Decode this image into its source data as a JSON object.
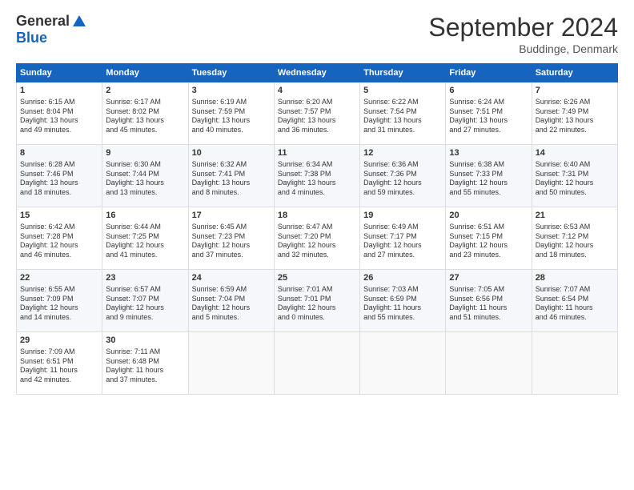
{
  "header": {
    "logo_general": "General",
    "logo_blue": "Blue",
    "month_title": "September 2024",
    "location": "Buddinge, Denmark"
  },
  "days_of_week": [
    "Sunday",
    "Monday",
    "Tuesday",
    "Wednesday",
    "Thursday",
    "Friday",
    "Saturday"
  ],
  "weeks": [
    [
      {
        "day": "1",
        "info": "Sunrise: 6:15 AM\nSunset: 8:04 PM\nDaylight: 13 hours\nand 49 minutes."
      },
      {
        "day": "2",
        "info": "Sunrise: 6:17 AM\nSunset: 8:02 PM\nDaylight: 13 hours\nand 45 minutes."
      },
      {
        "day": "3",
        "info": "Sunrise: 6:19 AM\nSunset: 7:59 PM\nDaylight: 13 hours\nand 40 minutes."
      },
      {
        "day": "4",
        "info": "Sunrise: 6:20 AM\nSunset: 7:57 PM\nDaylight: 13 hours\nand 36 minutes."
      },
      {
        "day": "5",
        "info": "Sunrise: 6:22 AM\nSunset: 7:54 PM\nDaylight: 13 hours\nand 31 minutes."
      },
      {
        "day": "6",
        "info": "Sunrise: 6:24 AM\nSunset: 7:51 PM\nDaylight: 13 hours\nand 27 minutes."
      },
      {
        "day": "7",
        "info": "Sunrise: 6:26 AM\nSunset: 7:49 PM\nDaylight: 13 hours\nand 22 minutes."
      }
    ],
    [
      {
        "day": "8",
        "info": "Sunrise: 6:28 AM\nSunset: 7:46 PM\nDaylight: 13 hours\nand 18 minutes."
      },
      {
        "day": "9",
        "info": "Sunrise: 6:30 AM\nSunset: 7:44 PM\nDaylight: 13 hours\nand 13 minutes."
      },
      {
        "day": "10",
        "info": "Sunrise: 6:32 AM\nSunset: 7:41 PM\nDaylight: 13 hours\nand 8 minutes."
      },
      {
        "day": "11",
        "info": "Sunrise: 6:34 AM\nSunset: 7:38 PM\nDaylight: 13 hours\nand 4 minutes."
      },
      {
        "day": "12",
        "info": "Sunrise: 6:36 AM\nSunset: 7:36 PM\nDaylight: 12 hours\nand 59 minutes."
      },
      {
        "day": "13",
        "info": "Sunrise: 6:38 AM\nSunset: 7:33 PM\nDaylight: 12 hours\nand 55 minutes."
      },
      {
        "day": "14",
        "info": "Sunrise: 6:40 AM\nSunset: 7:31 PM\nDaylight: 12 hours\nand 50 minutes."
      }
    ],
    [
      {
        "day": "15",
        "info": "Sunrise: 6:42 AM\nSunset: 7:28 PM\nDaylight: 12 hours\nand 46 minutes."
      },
      {
        "day": "16",
        "info": "Sunrise: 6:44 AM\nSunset: 7:25 PM\nDaylight: 12 hours\nand 41 minutes."
      },
      {
        "day": "17",
        "info": "Sunrise: 6:45 AM\nSunset: 7:23 PM\nDaylight: 12 hours\nand 37 minutes."
      },
      {
        "day": "18",
        "info": "Sunrise: 6:47 AM\nSunset: 7:20 PM\nDaylight: 12 hours\nand 32 minutes."
      },
      {
        "day": "19",
        "info": "Sunrise: 6:49 AM\nSunset: 7:17 PM\nDaylight: 12 hours\nand 27 minutes."
      },
      {
        "day": "20",
        "info": "Sunrise: 6:51 AM\nSunset: 7:15 PM\nDaylight: 12 hours\nand 23 minutes."
      },
      {
        "day": "21",
        "info": "Sunrise: 6:53 AM\nSunset: 7:12 PM\nDaylight: 12 hours\nand 18 minutes."
      }
    ],
    [
      {
        "day": "22",
        "info": "Sunrise: 6:55 AM\nSunset: 7:09 PM\nDaylight: 12 hours\nand 14 minutes."
      },
      {
        "day": "23",
        "info": "Sunrise: 6:57 AM\nSunset: 7:07 PM\nDaylight: 12 hours\nand 9 minutes."
      },
      {
        "day": "24",
        "info": "Sunrise: 6:59 AM\nSunset: 7:04 PM\nDaylight: 12 hours\nand 5 minutes."
      },
      {
        "day": "25",
        "info": "Sunrise: 7:01 AM\nSunset: 7:01 PM\nDaylight: 12 hours\nand 0 minutes."
      },
      {
        "day": "26",
        "info": "Sunrise: 7:03 AM\nSunset: 6:59 PM\nDaylight: 11 hours\nand 55 minutes."
      },
      {
        "day": "27",
        "info": "Sunrise: 7:05 AM\nSunset: 6:56 PM\nDaylight: 11 hours\nand 51 minutes."
      },
      {
        "day": "28",
        "info": "Sunrise: 7:07 AM\nSunset: 6:54 PM\nDaylight: 11 hours\nand 46 minutes."
      }
    ],
    [
      {
        "day": "29",
        "info": "Sunrise: 7:09 AM\nSunset: 6:51 PM\nDaylight: 11 hours\nand 42 minutes."
      },
      {
        "day": "30",
        "info": "Sunrise: 7:11 AM\nSunset: 6:48 PM\nDaylight: 11 hours\nand 37 minutes."
      },
      {
        "day": "",
        "info": ""
      },
      {
        "day": "",
        "info": ""
      },
      {
        "day": "",
        "info": ""
      },
      {
        "day": "",
        "info": ""
      },
      {
        "day": "",
        "info": ""
      }
    ]
  ]
}
